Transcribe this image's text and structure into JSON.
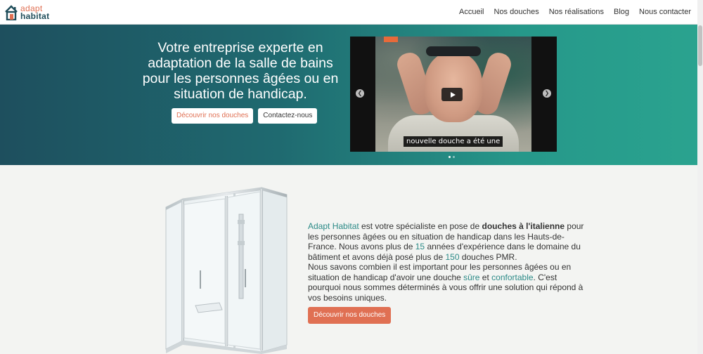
{
  "brand": {
    "line1": "adapt",
    "line2": "habitat"
  },
  "nav": {
    "items": [
      {
        "label": "Accueil"
      },
      {
        "label": "Nos douches"
      },
      {
        "label": "Nos réalisations"
      },
      {
        "label": "Blog"
      },
      {
        "label": "Nous contacter"
      }
    ]
  },
  "hero": {
    "title": "Votre entreprise experte en adaptation de la salle de bains pour les personnes âgées ou en situation de handicap.",
    "btn_primary": "Découvrir nos douches",
    "btn_secondary": "Contactez-nous",
    "video_subtitle": "nouvelle douche a été une"
  },
  "intro": {
    "brand_name": "Adapt Habitat",
    "t1": " est votre spécialiste en pose de ",
    "bold1": "douches à l'italienne",
    "t2": " pour les personnes âgées ou en situation de handicap dans les Hauts-de-France. Nous avons plus de ",
    "years": "15",
    "t3": " années d'expérience dans le domaine du bâtiment et avons déjà posé plus de ",
    "count": "150",
    "t4": " douches PMR.",
    "t5": "Nous savons combien il est important pour les personnes âgées ou en situation de handicap d'avoir une douche ",
    "sure": "sûre",
    "t6": " et ",
    "comfort": "confortable",
    "t7": ". C'est pourquoi nous sommes déterminés à vous offrir une solution qui répond à vos besoins uniques.",
    "cta": "Découvrir nos douches"
  },
  "colors": {
    "accent": "#e07053",
    "teal": "#2b8a87",
    "hero_dark": "#1e4f5e",
    "hero_light": "#2aa38f"
  }
}
